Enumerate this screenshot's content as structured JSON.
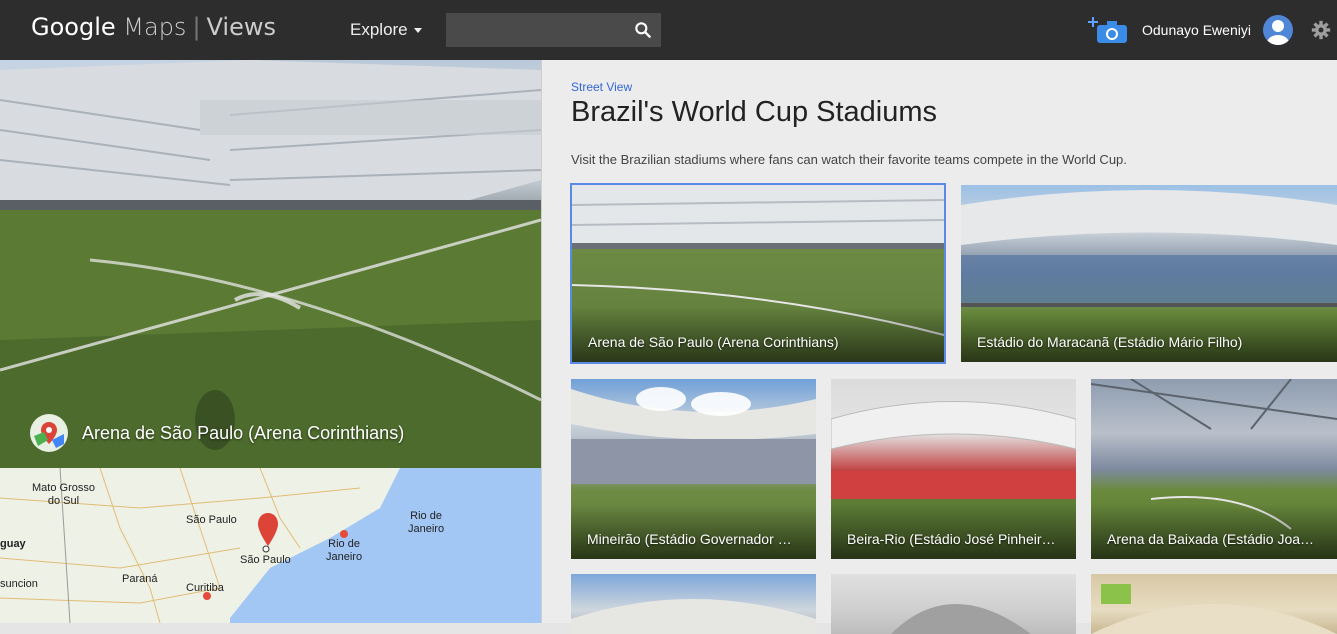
{
  "header": {
    "logo_google": "Google",
    "logo_maps": "Maps",
    "logo_views": "Views",
    "explore_label": "Explore",
    "search_value": "",
    "user_name": "Odunayo Eweniyi"
  },
  "pano": {
    "title": "Arena de São Paulo (Arena Corinthians)"
  },
  "map": {
    "labels": {
      "mato_grosso": "Mato Grosso\ndo Sul",
      "sao_paulo_state": "São Paulo",
      "sao_paulo_city": "São Paulo",
      "rio_state": "Rio de\nJaneiro",
      "rio_city": "Rio de\nJaneiro",
      "guay": "guay",
      "parana": "Paraná",
      "curitiba": "Curitiba",
      "asuncion": "suncion"
    }
  },
  "content": {
    "breadcrumb": "Street View",
    "title": "Brazil's World Cup Stadiums",
    "description": "Visit the Brazilian stadiums where fans can watch their favorite teams compete in the World Cup.",
    "tiles": [
      {
        "title": "Arena de São Paulo (Arena Corinthians)"
      },
      {
        "title": "Estádio do Maracanã (Estádio Mário Filho)"
      },
      {
        "title": "Mineirão (Estádio Governador Magalhães Pinto)"
      },
      {
        "title": "Beira-Rio (Estádio José Pinheiro Borda)"
      },
      {
        "title": "Arena da Baixada (Estádio Joaquim Américo Guimarães)"
      },
      {
        "title": ""
      },
      {
        "title": ""
      },
      {
        "title": ""
      }
    ]
  },
  "colors": {
    "topbar": "#2d2d2d",
    "accent": "#3367d6",
    "selection": "#5b8ae6",
    "map_pin": "#db4437"
  }
}
